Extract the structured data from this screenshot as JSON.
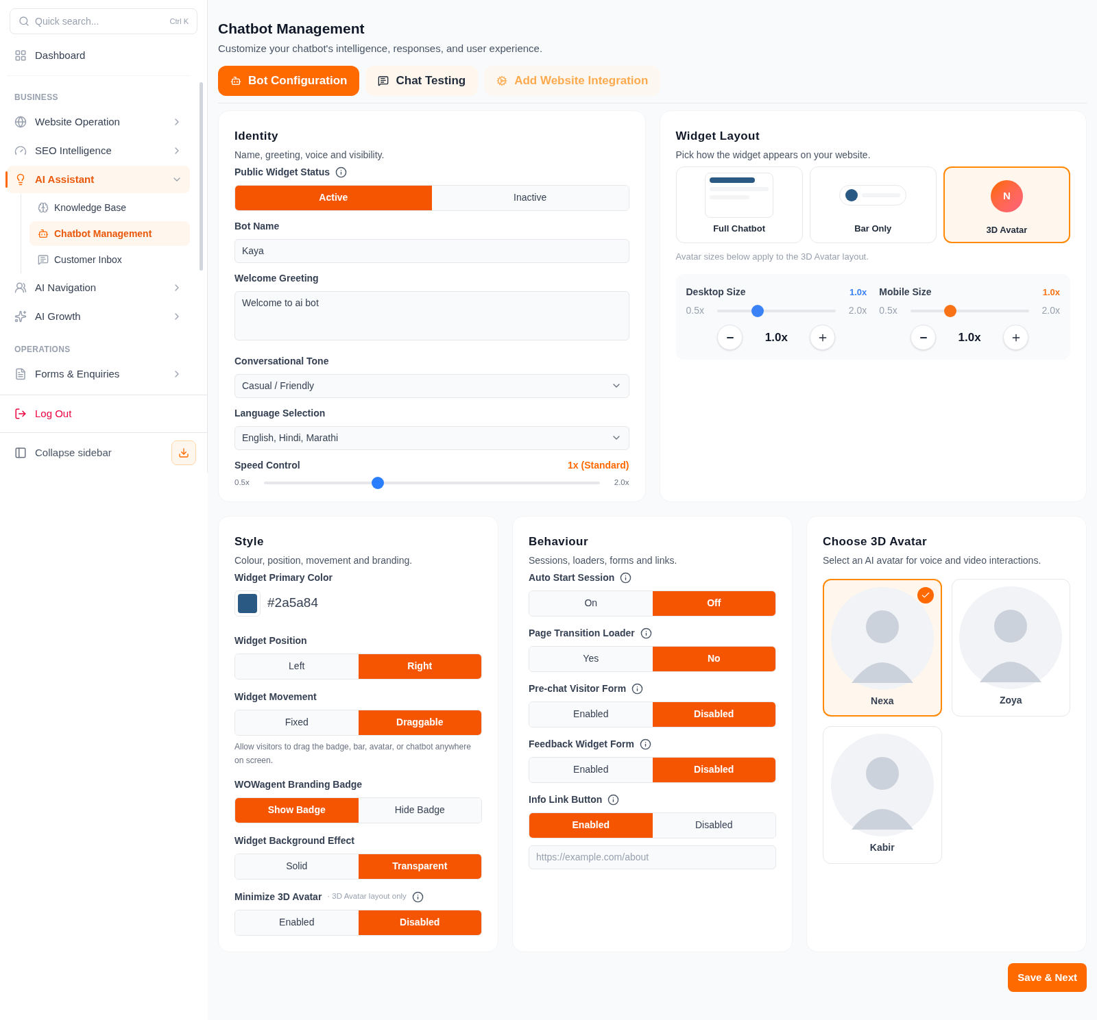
{
  "sidebar": {
    "search": {
      "placeholder": "Quick search...",
      "shortcut": "Ctrl K"
    },
    "items": [
      {
        "kind": "link",
        "label": "Dashboard"
      },
      {
        "kind": "section",
        "label": "BUSINESS"
      },
      {
        "kind": "group",
        "label": "Website Operation",
        "expanded": false,
        "selected": false
      },
      {
        "kind": "group",
        "label": "SEO Intelligence",
        "expanded": false,
        "selected": false
      },
      {
        "kind": "group",
        "label": "AI Assistant",
        "expanded": true,
        "selected": true,
        "children": [
          {
            "label": "Knowledge Base",
            "selected": false
          },
          {
            "label": "Chatbot Management",
            "selected": true
          },
          {
            "label": "Customer Inbox",
            "selected": false
          }
        ]
      },
      {
        "kind": "group",
        "label": "AI Navigation",
        "expanded": false,
        "selected": false
      },
      {
        "kind": "group",
        "label": "AI Growth",
        "expanded": false,
        "selected": false
      },
      {
        "kind": "section",
        "label": "OPERATIONS"
      },
      {
        "kind": "group",
        "label": "Forms & Enquiries",
        "expanded": false,
        "selected": false
      }
    ],
    "logout": "Log Out",
    "collapse": "Collapse sidebar"
  },
  "header": {
    "title": "Chatbot Management",
    "subtitle": "Customize your chatbot's intelligence, responses, and user experience."
  },
  "tabs": [
    {
      "label": "Bot Configuration",
      "selected": true,
      "disabled": false
    },
    {
      "label": "Chat Testing",
      "selected": false,
      "disabled": false
    },
    {
      "label": "Add Website Integration",
      "selected": false,
      "disabled": true
    }
  ],
  "identity": {
    "title": "Identity",
    "subtitle": "Name, greeting, voice and visibility.",
    "fields": [
      {
        "kind": "segmented",
        "label": "Public Widget Status",
        "info": true,
        "options": [
          {
            "label": "Active",
            "selected": true
          },
          {
            "label": "Inactive",
            "selected": false
          }
        ]
      },
      {
        "kind": "text",
        "label": "Bot Name",
        "value": "Kaya"
      },
      {
        "kind": "textarea",
        "label": "Welcome Greeting",
        "value": "Welcome to ai bot"
      },
      {
        "kind": "select",
        "label": "Conversational Tone",
        "value": "Casual / Friendly"
      },
      {
        "kind": "select",
        "label": "Language Selection",
        "value": "English, Hindi, Marathi"
      },
      {
        "kind": "slider",
        "label": "Speed Control",
        "reading": "1x (Standard)",
        "min_label": "0.5x",
        "max_label": "2.0x",
        "level": 0.34
      }
    ]
  },
  "widget_layout": {
    "title": "Widget Layout",
    "subtitle": "Pick how the widget appears on your website.",
    "layouts": [
      {
        "kind": "full",
        "label": "Full Chatbot",
        "selected": false
      },
      {
        "kind": "bar",
        "label": "Bar Only",
        "selected": false
      },
      {
        "kind": "avatar",
        "label": "3D Avatar",
        "initial": "N",
        "selected": true
      }
    ],
    "note": "Avatar sizes below apply to the 3D Avatar layout.",
    "sizes": [
      {
        "label": "Desktop Size",
        "reading": "1.0x",
        "min_label": "0.5x",
        "max_label": "2.0x",
        "level": 0.34,
        "value": "1.0x",
        "color": "#3b82f6"
      },
      {
        "label": "Mobile Size",
        "reading": "1.0x",
        "min_label": "0.5x",
        "max_label": "2.0x",
        "level": 0.34,
        "value": "1.0x",
        "color": "#f97316"
      }
    ]
  },
  "style": {
    "title": "Style",
    "subtitle": "Colour, position, movement and branding.",
    "fields": [
      {
        "kind": "color",
        "label": "Widget Primary Color",
        "value": "#2a5a84"
      },
      {
        "kind": "segmented",
        "label": "Widget Position",
        "options": [
          {
            "label": "Left",
            "selected": false
          },
          {
            "label": "Right",
            "selected": true
          }
        ]
      },
      {
        "kind": "segmented",
        "label": "Widget Movement",
        "options": [
          {
            "label": "Fixed",
            "selected": false
          },
          {
            "label": "Draggable",
            "selected": true
          }
        ],
        "note": "Allow visitors to drag the badge, bar, avatar, or chatbot anywhere on screen."
      },
      {
        "kind": "segmented",
        "label": "WOWagent Branding Badge",
        "options": [
          {
            "label": "Show Badge",
            "selected": true
          },
          {
            "label": "Hide Badge",
            "selected": false
          }
        ]
      },
      {
        "kind": "segmented",
        "label": "Widget Background Effect",
        "options": [
          {
            "label": "Solid",
            "selected": false
          },
          {
            "label": "Transparent",
            "selected": true
          }
        ]
      },
      {
        "kind": "segmented",
        "label": "Minimize 3D Avatar",
        "hint": "· 3D Avatar layout only",
        "info": true,
        "options": [
          {
            "label": "Enabled",
            "selected": false
          },
          {
            "label": "Disabled",
            "selected": true
          }
        ]
      }
    ]
  },
  "behaviour": {
    "title": "Behaviour",
    "subtitle": "Sessions, loaders, forms and links.",
    "fields": [
      {
        "kind": "segmented",
        "label": "Auto Start Session",
        "info": true,
        "options": [
          {
            "label": "On",
            "selected": false
          },
          {
            "label": "Off",
            "selected": true
          }
        ]
      },
      {
        "kind": "segmented",
        "label": "Page Transition Loader",
        "info": true,
        "options": [
          {
            "label": "Yes",
            "selected": false
          },
          {
            "label": "No",
            "selected": true
          }
        ]
      },
      {
        "kind": "segmented",
        "label": "Pre-chat Visitor Form",
        "info": true,
        "options": [
          {
            "label": "Enabled",
            "selected": false
          },
          {
            "label": "Disabled",
            "selected": true
          }
        ]
      },
      {
        "kind": "segmented",
        "label": "Feedback Widget Form",
        "info": true,
        "options": [
          {
            "label": "Enabled",
            "selected": false
          },
          {
            "label": "Disabled",
            "selected": true
          }
        ]
      },
      {
        "kind": "segmented",
        "label": "Info Link Button",
        "info": true,
        "options": [
          {
            "label": "Enabled",
            "selected": true
          },
          {
            "label": "Disabled",
            "selected": false
          }
        ]
      },
      {
        "kind": "input",
        "placeholder": "https://example.com/about"
      }
    ]
  },
  "avatars": {
    "title": "Choose 3D Avatar",
    "subtitle": "Select an AI avatar for voice and video interactions.",
    "items": [
      {
        "name": "Nexa",
        "selected": true
      },
      {
        "name": "Zoya",
        "selected": false
      },
      {
        "name": "Kabir",
        "selected": false
      }
    ]
  },
  "save_button": "Save & Next"
}
